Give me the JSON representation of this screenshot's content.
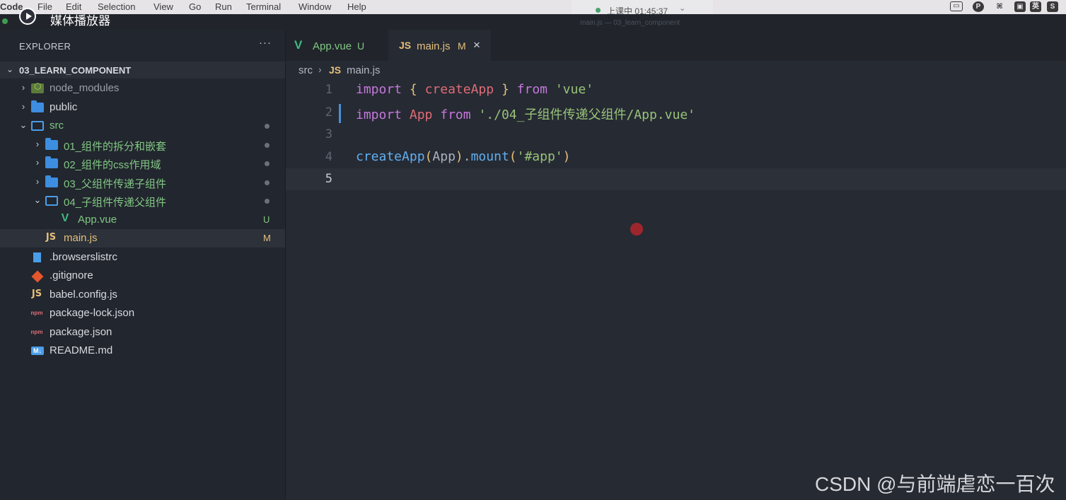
{
  "menubar": {
    "app_name": "Code",
    "items": [
      "File",
      "Edit",
      "Selection",
      "View",
      "Go",
      "Run",
      "Terminal",
      "Window",
      "Help"
    ],
    "status": {
      "text": "上课中 01:45:37",
      "chevron": "⌄"
    },
    "tray_icons": [
      "▭",
      "P",
      "⌘",
      "▣",
      "英",
      "S"
    ]
  },
  "window_title": "main.js — 03_learn_component",
  "media_player": {
    "title": "媒体播放器"
  },
  "sidebar": {
    "title": "EXPLORER",
    "more": "···",
    "root": {
      "chevron": "⌄",
      "label": "03_LEARN_COMPONENT"
    },
    "items": [
      {
        "label": "node_modules",
        "kind": "node-folder",
        "chevron": "›",
        "indent": 0,
        "style": "muted",
        "badge": "",
        "dot": false
      },
      {
        "label": "public",
        "kind": "folder",
        "chevron": "›",
        "indent": 0,
        "style": "",
        "badge": "",
        "dot": false
      },
      {
        "label": "src",
        "kind": "folder-open",
        "chevron": "⌄",
        "indent": 0,
        "style": "green",
        "badge": "",
        "dot": true
      },
      {
        "label": "01_组件的拆分和嵌套",
        "kind": "folder",
        "chevron": "›",
        "indent": 1,
        "style": "green",
        "badge": "",
        "dot": true
      },
      {
        "label": "02_组件的css作用域",
        "kind": "folder",
        "chevron": "›",
        "indent": 1,
        "style": "green",
        "badge": "",
        "dot": true
      },
      {
        "label": "03_父组件传递子组件",
        "kind": "folder",
        "chevron": "›",
        "indent": 1,
        "style": "green",
        "badge": "",
        "dot": true
      },
      {
        "label": "04_子组件传递父组件",
        "kind": "folder-open",
        "chevron": "⌄",
        "indent": 1,
        "style": "green",
        "badge": "",
        "dot": true
      },
      {
        "label": "App.vue",
        "kind": "vue",
        "chevron": "",
        "indent": 2,
        "style": "green",
        "badge": "U",
        "dot": false
      },
      {
        "label": "main.js",
        "kind": "js",
        "chevron": "",
        "indent": 1,
        "style": "modified",
        "badge": "M",
        "dot": false,
        "selected": true
      },
      {
        "label": ".browserslistrc",
        "kind": "file",
        "chevron": "",
        "indent": 0,
        "style": "",
        "badge": "",
        "dot": false
      },
      {
        "label": ".gitignore",
        "kind": "git",
        "chevron": "",
        "indent": 0,
        "style": "",
        "badge": "",
        "dot": false
      },
      {
        "label": "babel.config.js",
        "kind": "js",
        "chevron": "",
        "indent": 0,
        "style": "",
        "badge": "",
        "dot": false
      },
      {
        "label": "package-lock.json",
        "kind": "npm",
        "chevron": "",
        "indent": 0,
        "style": "",
        "badge": "",
        "dot": false
      },
      {
        "label": "package.json",
        "kind": "npm",
        "chevron": "",
        "indent": 0,
        "style": "",
        "badge": "",
        "dot": false
      },
      {
        "label": "README.md",
        "kind": "md",
        "chevron": "",
        "indent": 0,
        "style": "",
        "badge": "",
        "dot": false
      }
    ]
  },
  "tabs": [
    {
      "label": "App.vue",
      "icon": "vue-icon",
      "icon_text": "V",
      "badge": "U",
      "active": false
    },
    {
      "label": "main.js",
      "icon": "js-icon",
      "icon_text": "JS",
      "badge": "M",
      "active": true,
      "close": "×"
    }
  ],
  "breadcrumb": {
    "folder": "src",
    "separator": "›",
    "file_icon": "JS",
    "file": "main.js"
  },
  "editor": {
    "lines": [
      {
        "no": "1",
        "tokens": [
          [
            "kw",
            "import"
          ],
          [
            "plain",
            " "
          ],
          [
            "brace",
            "{"
          ],
          [
            "plain",
            " "
          ],
          [
            "fn-red",
            "createApp"
          ],
          [
            "plain",
            " "
          ],
          [
            "brace",
            "}"
          ],
          [
            "plain",
            " "
          ],
          [
            "kw",
            "from"
          ],
          [
            "plain",
            " "
          ],
          [
            "str",
            "'vue'"
          ]
        ]
      },
      {
        "no": "2",
        "tokens": [
          [
            "kw",
            "import"
          ],
          [
            "plain",
            " "
          ],
          [
            "var",
            "App"
          ],
          [
            "plain",
            " "
          ],
          [
            "kw",
            "from"
          ],
          [
            "plain",
            " "
          ],
          [
            "str",
            "'./04_子组件传递父组件/App.vue'"
          ]
        ],
        "changed": true
      },
      {
        "no": "3",
        "tokens": []
      },
      {
        "no": "4",
        "tokens": [
          [
            "fn",
            "createApp"
          ],
          [
            "brace",
            "("
          ],
          [
            "plain",
            "App"
          ],
          [
            "brace",
            ")"
          ],
          [
            "plain",
            "."
          ],
          [
            "fn",
            "mount"
          ],
          [
            "brace",
            "("
          ],
          [
            "str",
            "'#app'"
          ],
          [
            "brace",
            ")"
          ]
        ]
      },
      {
        "no": "5",
        "tokens": [],
        "current": true
      }
    ]
  },
  "watermark": "CSDN @与前端虐恋一百次",
  "colors": {
    "accent_green": "#81c784",
    "modified_yellow": "#e5c07b",
    "keyword_purple": "#c678dd",
    "function_blue": "#61afef",
    "string_green": "#98c379"
  }
}
